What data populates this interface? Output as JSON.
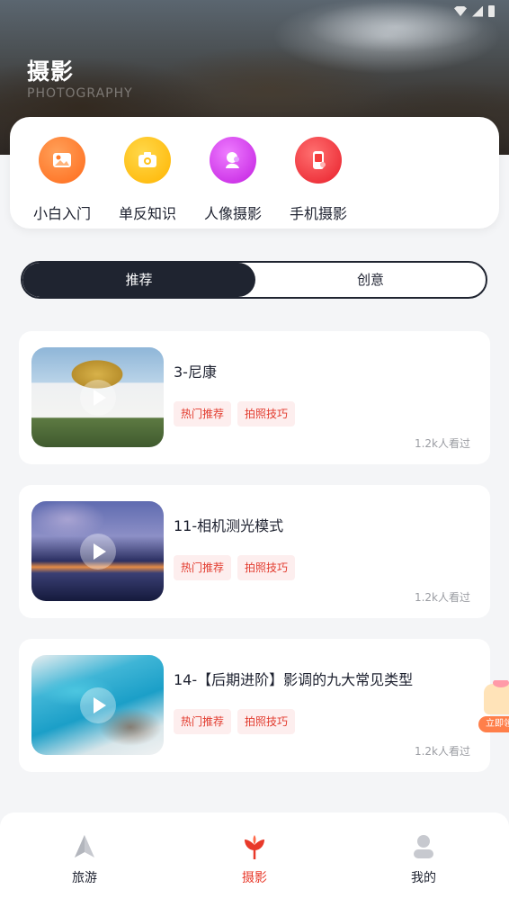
{
  "header": {
    "title": "摄影",
    "subtitle": "PHOTOGRAPHY"
  },
  "categories": [
    {
      "label": "小白入门",
      "icon": "picture-icon",
      "color": "#ff7a28"
    },
    {
      "label": "单反知识",
      "icon": "camera-icon",
      "color": "#ffc21a"
    },
    {
      "label": "人像摄影",
      "icon": "portrait-icon",
      "color": "#d63cf0"
    },
    {
      "label": "手机摄影",
      "icon": "phone-icon",
      "color": "#f43c3c"
    }
  ],
  "tabs": {
    "active": "推荐",
    "inactive": "创意"
  },
  "videos": [
    {
      "title": "3-尼康",
      "tags": [
        "热门推荐",
        "拍照技巧"
      ],
      "views": "1.2k人看过"
    },
    {
      "title": "11-相机测光模式",
      "tags": [
        "热门推荐",
        "拍照技巧"
      ],
      "views": "1.2k人看过"
    },
    {
      "title": "14-【后期进阶】影调的九大常见类型",
      "tags": [
        "热门推荐",
        "拍照技巧"
      ],
      "views": "1.2k人看过"
    }
  ],
  "floating": {
    "label": "立即领"
  },
  "nav": [
    {
      "label": "旅游",
      "icon": "travel-icon",
      "active": false
    },
    {
      "label": "摄影",
      "icon": "photography-icon",
      "active": true
    },
    {
      "label": "我的",
      "icon": "profile-icon",
      "active": false
    }
  ],
  "colors": {
    "accent": "#e8392a",
    "dark": "#1f2430",
    "tag_bg": "#fdeeee"
  }
}
